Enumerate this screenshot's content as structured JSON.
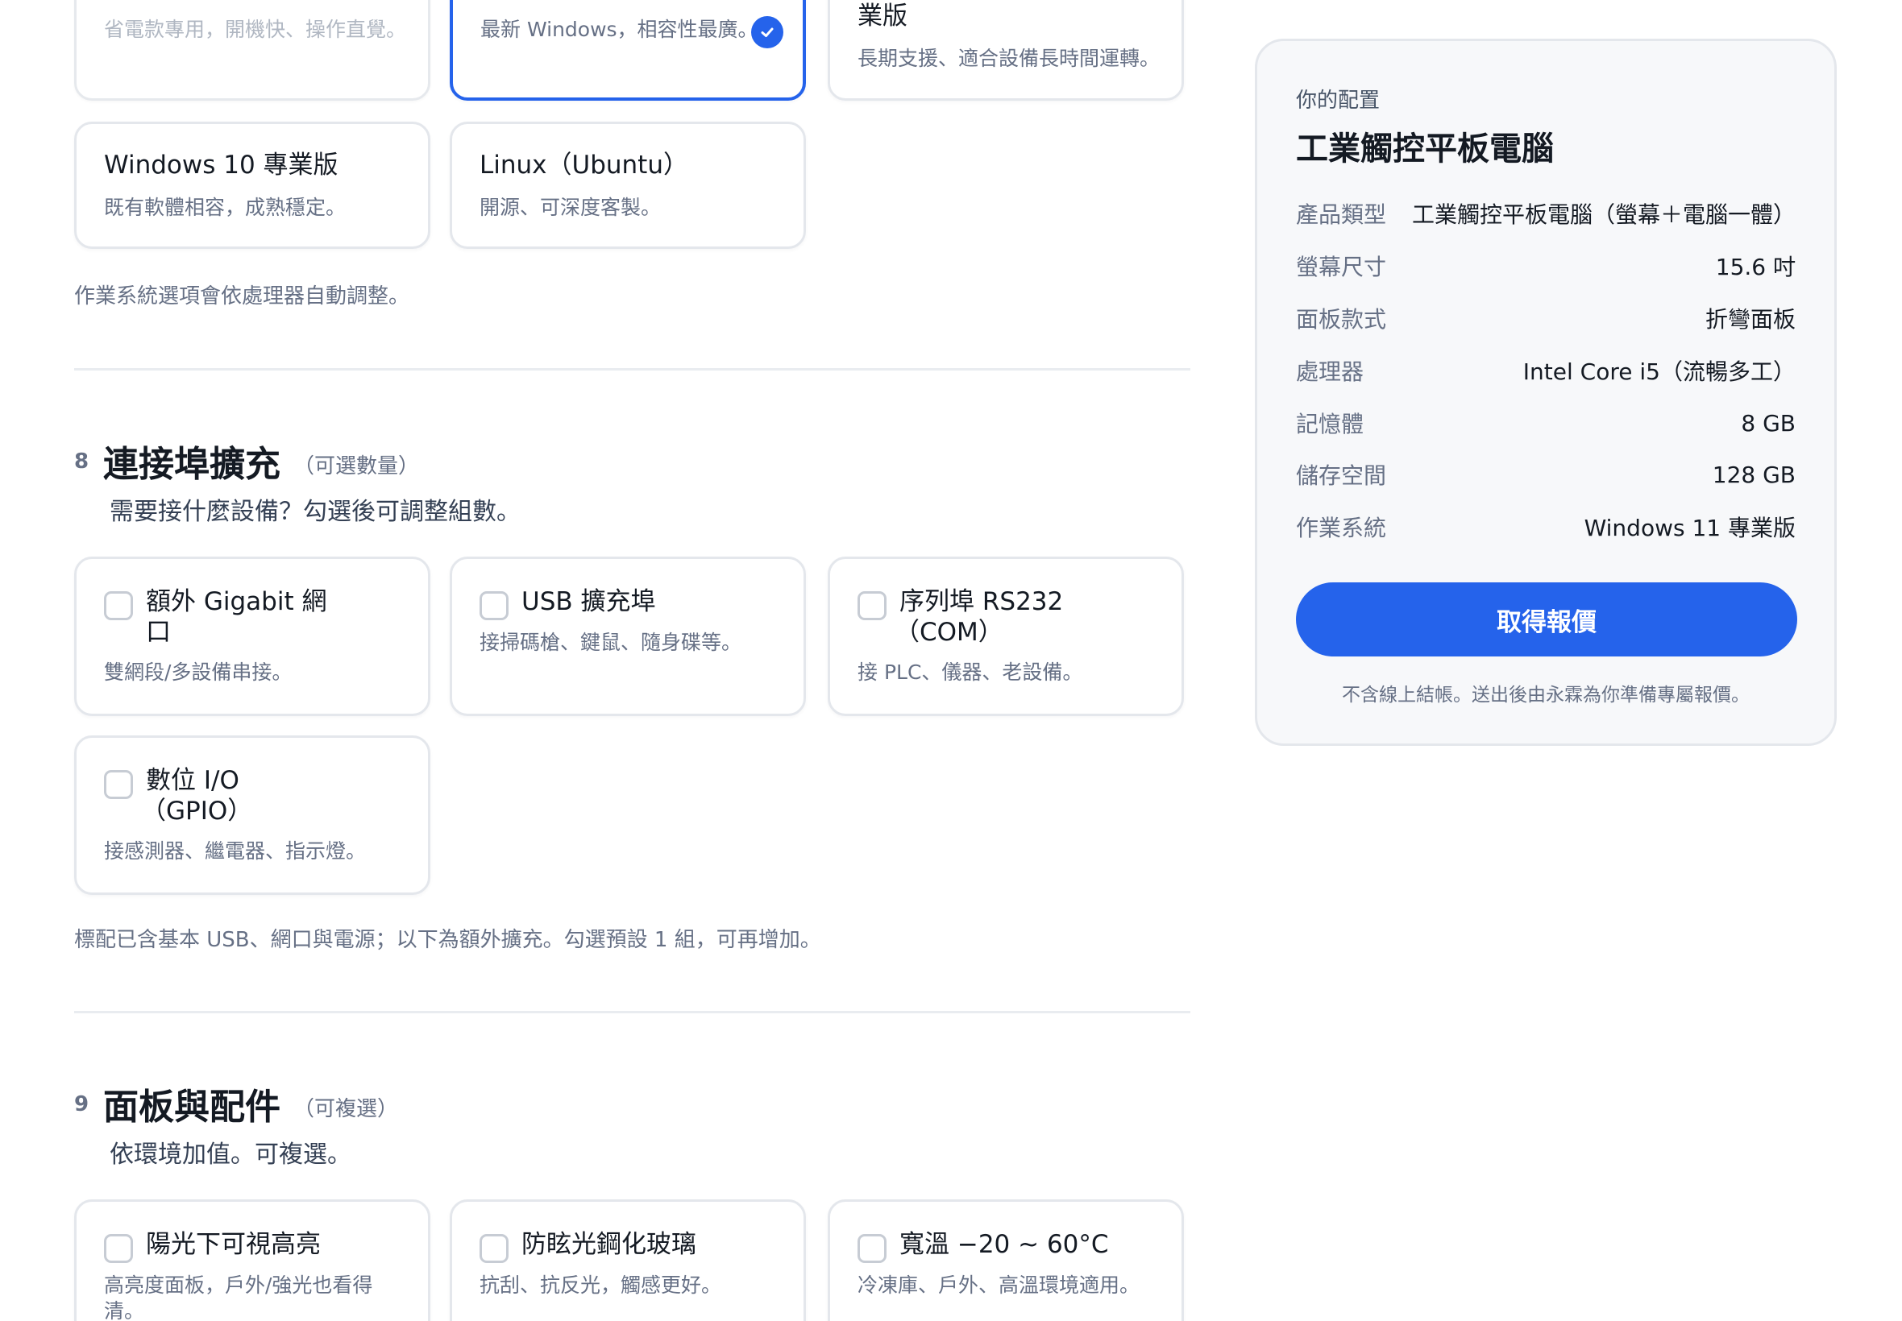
{
  "os_section": {
    "options": [
      {
        "title": "",
        "desc": "省電款專用，開機快、操作直覺。",
        "state": "disabled"
      },
      {
        "title": "",
        "desc": "最新 Windows，相容性最廣。",
        "state": "selected"
      },
      {
        "title": "業版",
        "desc": "長期支援、適合設備長時間運轉。",
        "state": "default"
      },
      {
        "title": "Windows 10 專業版",
        "desc": "既有軟體相容，成熟穩定。",
        "state": "default"
      },
      {
        "title": "Linux（Ubuntu）",
        "desc": "開源、可深度客製。",
        "state": "default"
      }
    ],
    "note": "作業系統選項會依處理器自動調整。"
  },
  "ports_section": {
    "number": "8",
    "title": "連接埠擴充",
    "tag": "（可選數量）",
    "subtitle": "需要接什麼設備？勾選後可調整組數。",
    "options": [
      {
        "title_line1": "額外 Gigabit 網",
        "title_line2": "口",
        "desc": "雙網段/多設備串接。"
      },
      {
        "title_line1": "USB 擴充埠",
        "title_line2": "",
        "desc": "接掃碼槍、鍵鼠、隨身碟等。"
      },
      {
        "title_line1": "序列埠 RS232",
        "title_line2": "（COM）",
        "desc": "接 PLC、儀器、老設備。"
      },
      {
        "title_line1": "數位 I/O",
        "title_line2": "（GPIO）",
        "desc": "接感測器、繼電器、指示燈。"
      }
    ],
    "note": "標配已含基本 USB、網口與電源；以下為額外擴充。勾選預設 1 組，可再增加。"
  },
  "panel_section": {
    "number": "9",
    "title": "面板與配件",
    "tag": "（可複選）",
    "subtitle": "依環境加值。可複選。",
    "options": [
      {
        "title": "陽光下可視高亮",
        "desc_line1": "高亮度面板，戶外/強光也看得",
        "desc_line2": "清。"
      },
      {
        "title": "防眩光鋼化玻璃",
        "desc_line1": "抗刮、抗反光，觸感更好。",
        "desc_line2": ""
      },
      {
        "title": "寬溫 −20 ~ 60°C",
        "desc_line1": "冷凍庫、戶外、高溫環境適用。",
        "desc_line2": ""
      }
    ]
  },
  "summary": {
    "eyebrow": "你的配置",
    "title": "工業觸控平板電腦",
    "rows": [
      {
        "k": "產品類型",
        "v": "工業觸控平板電腦（螢幕＋電腦一體）"
      },
      {
        "k": "螢幕尺寸",
        "v": "15.6 吋"
      },
      {
        "k": "面板款式",
        "v": "折彎面板"
      },
      {
        "k": "處理器",
        "v": "Intel Core i5（流暢多工）"
      },
      {
        "k": "記憶體",
        "v": "8 GB"
      },
      {
        "k": "儲存空間",
        "v": "128 GB"
      },
      {
        "k": "作業系統",
        "v": "Windows 11 專業版"
      }
    ],
    "cta": "取得報價",
    "fine_print": "不含線上結帳。送出後由永霖為你準備專屬報價。"
  },
  "colors": {
    "accent": "#2563eb",
    "border": "#e4e7ec",
    "muted": "#667085"
  }
}
